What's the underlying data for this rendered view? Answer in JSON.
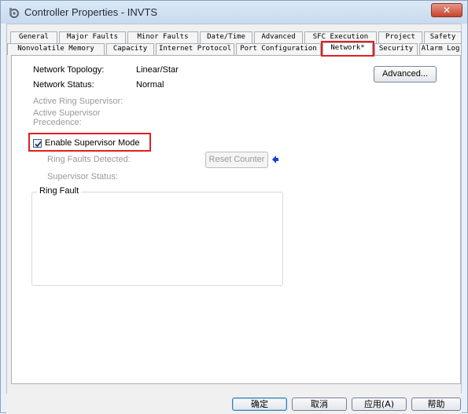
{
  "window": {
    "title": "Controller Properties - INVTS",
    "close_label": "✕"
  },
  "tabs_row1": [
    {
      "label": "General"
    },
    {
      "label": "Major Faults"
    },
    {
      "label": "Minor Faults"
    },
    {
      "label": "Date/Time"
    },
    {
      "label": "Advanced"
    },
    {
      "label": "SFC Execution"
    },
    {
      "label": "Project"
    },
    {
      "label": "Safety"
    }
  ],
  "tabs_row2": [
    {
      "label": "Nonvolatile Memory"
    },
    {
      "label": "Capacity"
    },
    {
      "label": "Internet Protocol"
    },
    {
      "label": "Port Configuration"
    },
    {
      "label": "Network*",
      "active": true
    },
    {
      "label": "Security"
    },
    {
      "label": "Alarm Log"
    }
  ],
  "network": {
    "topology_label": "Network Topology:",
    "topology_value": "Linear/Star",
    "status_label": "Network Status:",
    "status_value": "Normal",
    "advanced_button": "Advanced...",
    "active_ring_supervisor_label": "Active Ring Supervisor:",
    "active_supervisor_precedence_line1": "Active Supervisor",
    "active_supervisor_precedence_line2": "Precedence:",
    "enable_supervisor_label": "Enable Supervisor Mode",
    "enable_supervisor_checked": true,
    "ring_faults_detected_label": "Ring Faults Detected:",
    "reset_counter_button": "Reset Counter",
    "supervisor_status_label": "Supervisor Status:",
    "ring_fault_group_label": "Ring Fault"
  },
  "dialog_buttons": {
    "ok": "确定",
    "cancel": "取消",
    "apply": "应用(A)",
    "help": "帮助"
  },
  "colors": {
    "highlight": "#e02020",
    "arrow": "#1a3fd8",
    "title_bar": "#c8daee"
  }
}
